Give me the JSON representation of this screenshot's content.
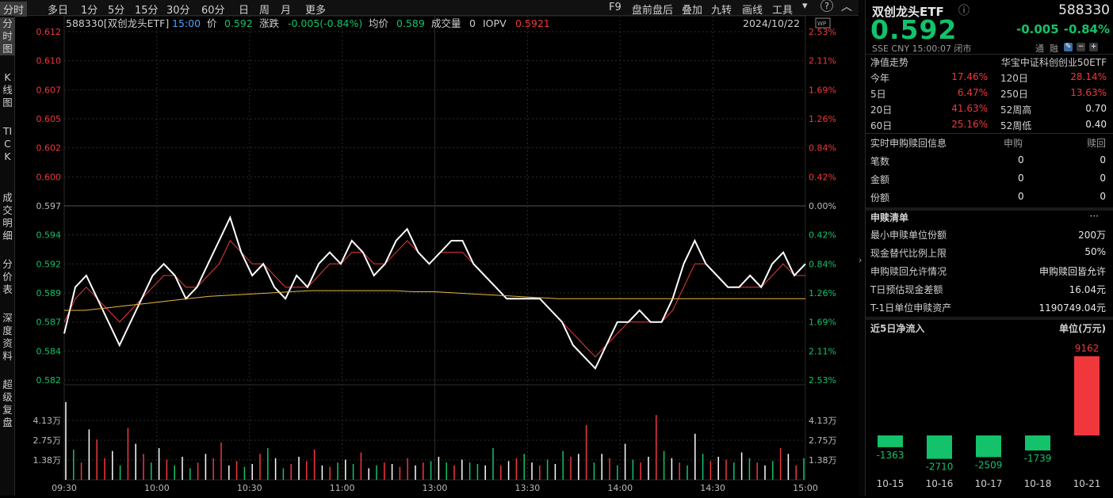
{
  "topbar": {
    "tabs": [
      "分时",
      "多日",
      "1分",
      "5分",
      "15分",
      "30分",
      "60分",
      "日",
      "周",
      "月",
      "更多"
    ],
    "tools": [
      "F9",
      "盘前盘后",
      "叠加",
      "九转",
      "画线",
      "工具"
    ]
  },
  "sidebar": [
    "分时图",
    "K线图",
    "TICK",
    "成交明细",
    "分价表",
    "深度资料",
    "超级复盘"
  ],
  "info_bar": {
    "code_name": "588330[双创龙头ETF]",
    "time": "15:00",
    "price_label": "价",
    "price": "0.592",
    "change_label": "涨跌",
    "change": "-0.005(-0.84%)",
    "avg_label": "均价",
    "avg": "0.589",
    "volume_label": "成交量",
    "volume": "0",
    "iopv_label": "IOPV",
    "iopv": "0.5921",
    "date": "2024/10/22",
    "wp_badge": "WP"
  },
  "chart_data": [
    {
      "type": "line",
      "name": "分时",
      "y_left_ticks": [
        "0.612",
        "0.610",
        "0.607",
        "0.605",
        "0.602",
        "0.600",
        "0.597",
        "0.594",
        "0.592",
        "0.589",
        "0.587",
        "0.584",
        "0.582"
      ],
      "y_right_ticks": [
        "2.53%",
        "2.11%",
        "1.69%",
        "1.26%",
        "0.84%",
        "0.42%",
        "0.00%",
        "0.42%",
        "0.84%",
        "1.26%",
        "1.69%",
        "2.11%",
        "2.53%"
      ],
      "ylim": [
        0.582,
        0.612
      ],
      "prev_close": 0.597,
      "x_ticks": [
        "09:30",
        "10:00",
        "10:30",
        "11:00",
        "13:00",
        "13:30",
        "14:00",
        "14:30",
        "15:00"
      ],
      "series": [
        {
          "values": [
            0.586,
            0.59,
            0.591,
            0.589,
            0.587,
            0.585,
            0.587,
            0.589,
            0.591,
            0.592,
            0.591,
            0.589,
            0.59,
            0.592,
            0.594,
            0.596,
            0.593,
            0.591,
            0.592,
            0.59,
            0.589,
            0.591,
            0.59,
            0.592,
            0.593,
            0.592,
            0.594,
            0.593,
            0.591,
            0.592,
            0.594,
            0.595,
            0.593,
            0.592,
            0.593,
            0.594,
            0.594,
            0.592,
            0.591,
            0.59,
            0.589,
            0.589,
            0.589,
            0.589,
            0.588,
            0.587,
            0.585,
            0.584,
            0.583,
            0.585,
            0.587,
            0.587,
            0.588,
            0.587,
            0.587,
            0.589,
            0.592,
            0.594,
            0.592,
            0.591,
            0.59,
            0.59,
            0.591,
            0.59,
            0.592,
            0.593,
            0.591,
            0.592
          ]
        },
        {
          "values": [
            0.587,
            0.589,
            0.59,
            0.589,
            0.588,
            0.587,
            0.588,
            0.589,
            0.59,
            0.591,
            0.591,
            0.59,
            0.59,
            0.591,
            0.592,
            0.594,
            0.593,
            0.592,
            0.592,
            0.591,
            0.59,
            0.59,
            0.59,
            0.591,
            0.592,
            0.592,
            0.593,
            0.593,
            0.592,
            0.592,
            0.593,
            0.594,
            0.593,
            0.592,
            0.593,
            0.593,
            0.593,
            0.592,
            0.591,
            0.59,
            0.589,
            0.589,
            0.589,
            0.589,
            0.588,
            0.587,
            0.586,
            0.585,
            0.584,
            0.585,
            0.586,
            0.587,
            0.587,
            0.587,
            0.587,
            0.588,
            0.59,
            0.592,
            0.592,
            0.591,
            0.59,
            0.59,
            0.59,
            0.59,
            0.591,
            0.592,
            0.591,
            0.591
          ]
        },
        {
          "values": [
            0.588,
            0.588,
            0.5882,
            0.5884,
            0.5886,
            0.5888,
            0.589,
            0.5892,
            0.5893,
            0.5894,
            0.5895,
            0.5896,
            0.5897,
            0.5897,
            0.5897,
            0.5897,
            0.5897,
            0.5896,
            0.5896,
            0.5895,
            0.5894,
            0.5893,
            0.5892,
            0.5891,
            0.589,
            0.589,
            0.589,
            0.589,
            0.589,
            0.589,
            0.589,
            0.589,
            0.589,
            0.589,
            0.589,
            0.589,
            0.589
          ]
        }
      ]
    },
    {
      "type": "bar",
      "name": "成交量",
      "y_ticks": [
        "4.13万",
        "2.75万",
        "1.38万"
      ],
      "ylim": [
        0,
        5.5
      ],
      "values": [
        5.4,
        2.1,
        1.2,
        3.5,
        2.8,
        1.5,
        2.0,
        1.0,
        3.6,
        2.5,
        1.8,
        1.2,
        2.2,
        1.4,
        1.0,
        1.6,
        0.8,
        1.2,
        1.8,
        1.5,
        2.6,
        1.0,
        1.3,
        0.9,
        1.1,
        1.8,
        2.2,
        1.5,
        0.8,
        1.1,
        1.6,
        1.3,
        2.1,
        1.0,
        0.9,
        1.2,
        1.4,
        1.1,
        1.9,
        0.8,
        1.0,
        1.2,
        1.1,
        0.9,
        1.5,
        1.0,
        1.2,
        1.3,
        1.6,
        1.2,
        1.0,
        1.4,
        1.2,
        1.1,
        1.0,
        2.2,
        1.0,
        1.3,
        1.5,
        1.8,
        1.2,
        1.0,
        1.4,
        1.1,
        2.0,
        1.6,
        1.8,
        3.8,
        1.2,
        1.8,
        1.5,
        1.0,
        2.5,
        1.4,
        1.2,
        1.6,
        4.5,
        2.0,
        1.5,
        1.2,
        1.0,
        3.2,
        1.8,
        1.3,
        1.6,
        1.4,
        1.2,
        1.9,
        1.5,
        1.2,
        1.0,
        1.3,
        2.2,
        1.8,
        1.0,
        1.5
      ],
      "up_down": [
        1,
        0,
        1,
        0,
        1,
        1,
        0,
        0,
        1,
        0,
        1,
        0,
        1,
        1,
        0,
        1,
        0,
        1,
        0,
        1,
        1,
        0,
        1,
        0,
        0,
        1,
        0,
        1,
        0,
        1,
        0,
        1,
        1,
        0,
        1,
        0,
        1,
        0,
        1,
        0,
        0,
        1,
        0,
        1,
        1,
        0,
        1,
        0,
        1,
        0,
        1,
        1,
        0,
        0,
        1,
        0,
        1,
        0,
        1,
        0,
        1,
        1,
        0,
        1,
        0,
        1,
        0,
        1,
        0,
        1,
        1,
        0,
        1,
        0,
        1,
        0,
        1,
        0,
        1,
        1,
        0,
        1,
        0,
        1,
        0,
        1,
        0,
        1,
        0,
        1,
        1,
        0,
        1,
        0,
        1,
        0
      ]
    }
  ],
  "quote": {
    "name": "双创龙头ETF",
    "code": "588330",
    "price": "0.592",
    "change": "-0.005",
    "change_pct": "-0.84%",
    "meta": "SSE  CNY  15:00:07  闭市",
    "flags": [
      "通",
      "融"
    ]
  },
  "nav": {
    "title": "净值走势",
    "index": "华宝中证科创创业50ETF",
    "rows": [
      {
        "l1": "今年",
        "v1": "17.46%",
        "l2": "120日",
        "v2": "28.14%"
      },
      {
        "l1": "5日",
        "v1": "6.47%",
        "l2": "250日",
        "v2": "13.63%"
      },
      {
        "l1": "20日",
        "v1": "41.63%",
        "l2": "52周高",
        "v2": "0.70"
      },
      {
        "l1": "60日",
        "v1": "25.16%",
        "l2": "52周低",
        "v2": "0.40"
      }
    ]
  },
  "realtime": {
    "title": "实时申购赎回信息",
    "col1": "申购",
    "col2": "赎回",
    "rows": [
      {
        "label": "笔数",
        "a": "0",
        "b": "0"
      },
      {
        "label": "金额",
        "a": "0",
        "b": "0"
      },
      {
        "label": "份额",
        "a": "0",
        "b": "0"
      }
    ]
  },
  "redeem_list": {
    "title": "申赎清单",
    "more": "···",
    "rows": [
      {
        "label": "最小申赎单位份额",
        "value": "200万"
      },
      {
        "label": "现金替代比例上限",
        "value": "50%"
      },
      {
        "label": "申购赎回允许情况",
        "value": "申购赎回皆允许"
      },
      {
        "label": "T日预估现金差额",
        "value": "16.04元"
      },
      {
        "label": "T-1日单位申赎资产",
        "value": "1190749.04元"
      }
    ]
  },
  "flow": {
    "title": "近5日净流入",
    "unit": "单位(万元)",
    "chart_data": {
      "type": "bar",
      "categories": [
        "10-15",
        "10-16",
        "10-17",
        "10-18",
        "10-21"
      ],
      "values": [
        -1363,
        -2710,
        -2509,
        -1739,
        9162
      ],
      "value_labels": [
        "-1363",
        "-2710",
        "-2509",
        "-1739",
        "9162"
      ]
    }
  },
  "colors": {
    "up": "#f0383c",
    "down": "#13c26b",
    "white": "#e6e6e6",
    "avg": "#e8b84a",
    "grid": "#2b2b2b"
  }
}
